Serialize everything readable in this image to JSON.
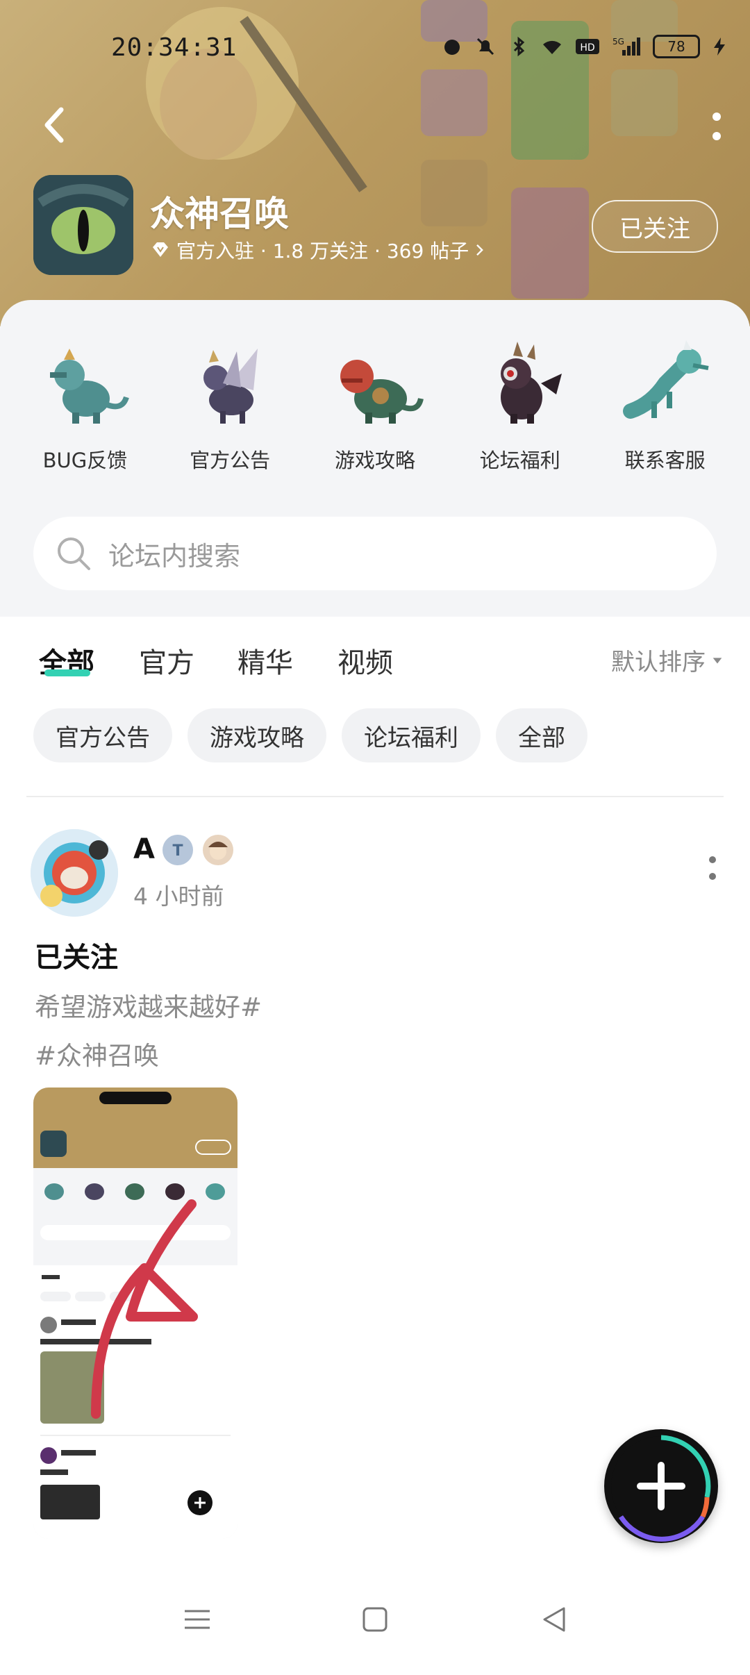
{
  "status_bar": {
    "time": "20:34:31",
    "battery": "78"
  },
  "header": {
    "title": "众神召唤",
    "meta": "官方入驻 · 1.8 万关注 · 369 帖子",
    "follow_label": "已关注"
  },
  "shortcuts": [
    {
      "label": "BUG反馈",
      "icon": "dragon-bug-report-icon"
    },
    {
      "label": "官方公告",
      "icon": "dragon-announcement-icon"
    },
    {
      "label": "游戏攻略",
      "icon": "dragon-guide-icon"
    },
    {
      "label": "论坛福利",
      "icon": "dragon-welfare-icon"
    },
    {
      "label": "联系客服",
      "icon": "dragon-support-icon"
    }
  ],
  "search": {
    "placeholder": "论坛内搜索"
  },
  "tabs": [
    {
      "label": "全部",
      "active": true
    },
    {
      "label": "官方"
    },
    {
      "label": "精华"
    },
    {
      "label": "视频"
    }
  ],
  "sort_label": "默认排序",
  "chips": [
    "官方公告",
    "游戏攻略",
    "论坛福利",
    "全部"
  ],
  "post": {
    "author": "A",
    "time": "4 小时前",
    "title": "已关注",
    "body_line1": "希望游戏越来越好#",
    "body_line2": "#众神召唤"
  },
  "colors": {
    "accent": "#33d1b3",
    "header_bg": "#b99a5f",
    "annotation_red": "#d0394a"
  }
}
